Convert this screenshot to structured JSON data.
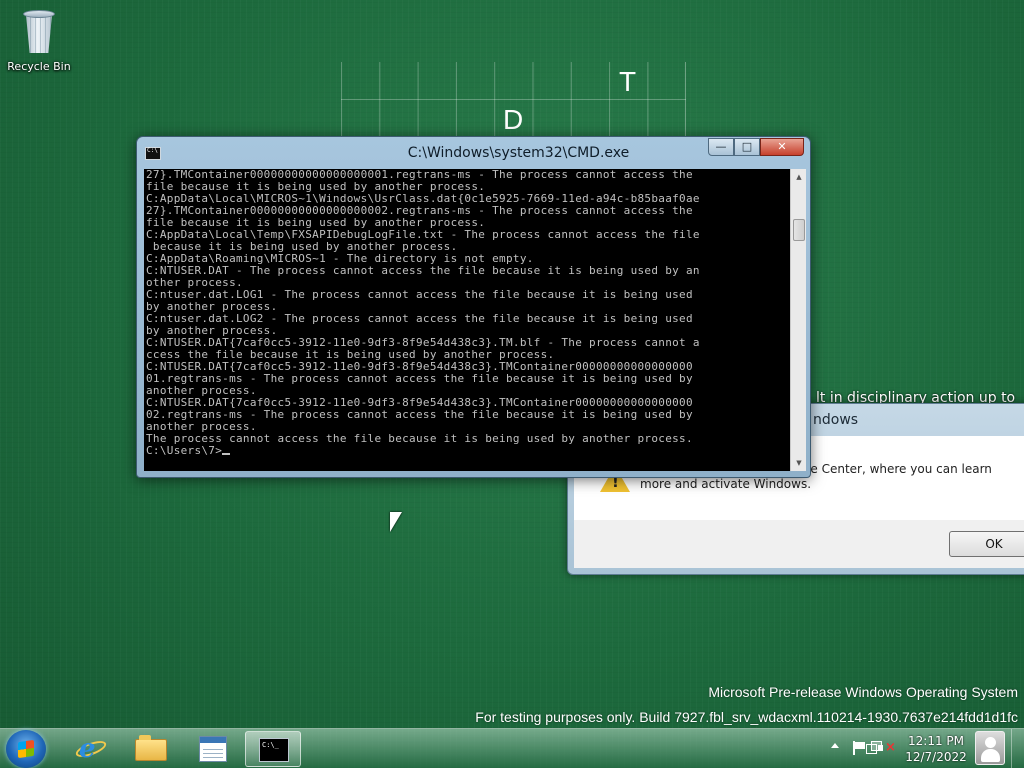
{
  "desktop": {
    "icons": [
      {
        "label": "Recycle Bin",
        "icon": "recycle-bin-icon"
      }
    ],
    "wallpaper_letters": [
      "T",
      "D"
    ]
  },
  "activation_dialog": {
    "title": "ndows",
    "behind_text": "lt in disciplinary action up to",
    "message": "Click OK to go to the Genuine Center, where you can learn more and activate Windows.",
    "ok_label": "OK",
    "icon": "warning-icon"
  },
  "cmd": {
    "title": "C:\\Windows\\system32\\CMD.exe",
    "buttons": {
      "minimize": "—",
      "maximize": "□",
      "close": "✕"
    },
    "lines": [
      "27}.TMContainer00000000000000000001.regtrans-ms - The process cannot access the",
      "file because it is being used by another process.",
      "C:AppData\\Local\\MICROS~1\\Windows\\UsrClass.dat{0c1e5925-7669-11ed-a94c-b85baaf0ae",
      "27}.TMContainer00000000000000000002.regtrans-ms - The process cannot access the",
      "file because it is being used by another process.",
      "C:AppData\\Local\\Temp\\FXSAPIDebugLogFile.txt - The process cannot access the file",
      " because it is being used by another process.",
      "C:AppData\\Roaming\\MICROS~1 - The directory is not empty.",
      "C:NTUSER.DAT - The process cannot access the file because it is being used by an",
      "other process.",
      "C:ntuser.dat.LOG1 - The process cannot access the file because it is being used",
      "by another process.",
      "C:ntuser.dat.LOG2 - The process cannot access the file because it is being used",
      "by another process.",
      "C:NTUSER.DAT{7caf0cc5-3912-11e0-9df3-8f9e54d438c3}.TM.blf - The process cannot a",
      "ccess the file because it is being used by another process.",
      "C:NTUSER.DAT{7caf0cc5-3912-11e0-9df3-8f9e54d438c3}.TMContainer00000000000000000",
      "01.regtrans-ms - The process cannot access the file because it is being used by",
      "another process.",
      "C:NTUSER.DAT{7caf0cc5-3912-11e0-9df3-8f9e54d438c3}.TMContainer00000000000000000",
      "02.regtrans-ms - The process cannot access the file because it is being used by",
      "another process.",
      "The process cannot access the file because it is being used by another process.",
      "",
      "C:\\Users\\7>"
    ]
  },
  "watermark": {
    "line1": "Microsoft Pre-release Windows Operating System",
    "line2": "For testing purposes only. Build 7927.fbl_srv_wdacxml.110214-1930.7637e214fdd1d1fc"
  },
  "taskbar": {
    "items": [
      {
        "name": "internet-explorer",
        "icon": "internet-explorer-icon"
      },
      {
        "name": "file-explorer",
        "icon": "folder-icon"
      },
      {
        "name": "windows-program",
        "icon": "window-icon"
      },
      {
        "name": "command-prompt",
        "icon": "cmd-icon",
        "active": true
      }
    ],
    "clock_time": "12:11 PM",
    "clock_date": "12/7/2022"
  }
}
